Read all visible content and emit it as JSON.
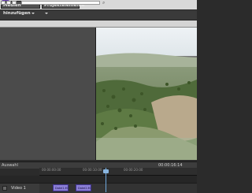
{
  "titlebar": {
    "app_icon_glyph": "⬢"
  },
  "menus": {
    "media": "Medien hinzufügen",
    "project": "Projektelemente"
  },
  "timeline": {
    "label": "Auswahl",
    "current_time": "00:00:16:14",
    "ruler_ticks": [
      "00:00:00:00",
      "00:00:10:00",
      "00:00:20:00"
    ],
    "track_name": "Video 1",
    "clips": [
      "Datei1.MP4",
      "Datei2.MP4"
    ]
  },
  "colors": {
    "accent": "#6a3fb5",
    "clip": "#8b7fd6",
    "playhead": "#6fa8dc"
  },
  "icons": [
    "app-icon",
    "search-icon",
    "lock-icon",
    "chevron-down-icon"
  ]
}
